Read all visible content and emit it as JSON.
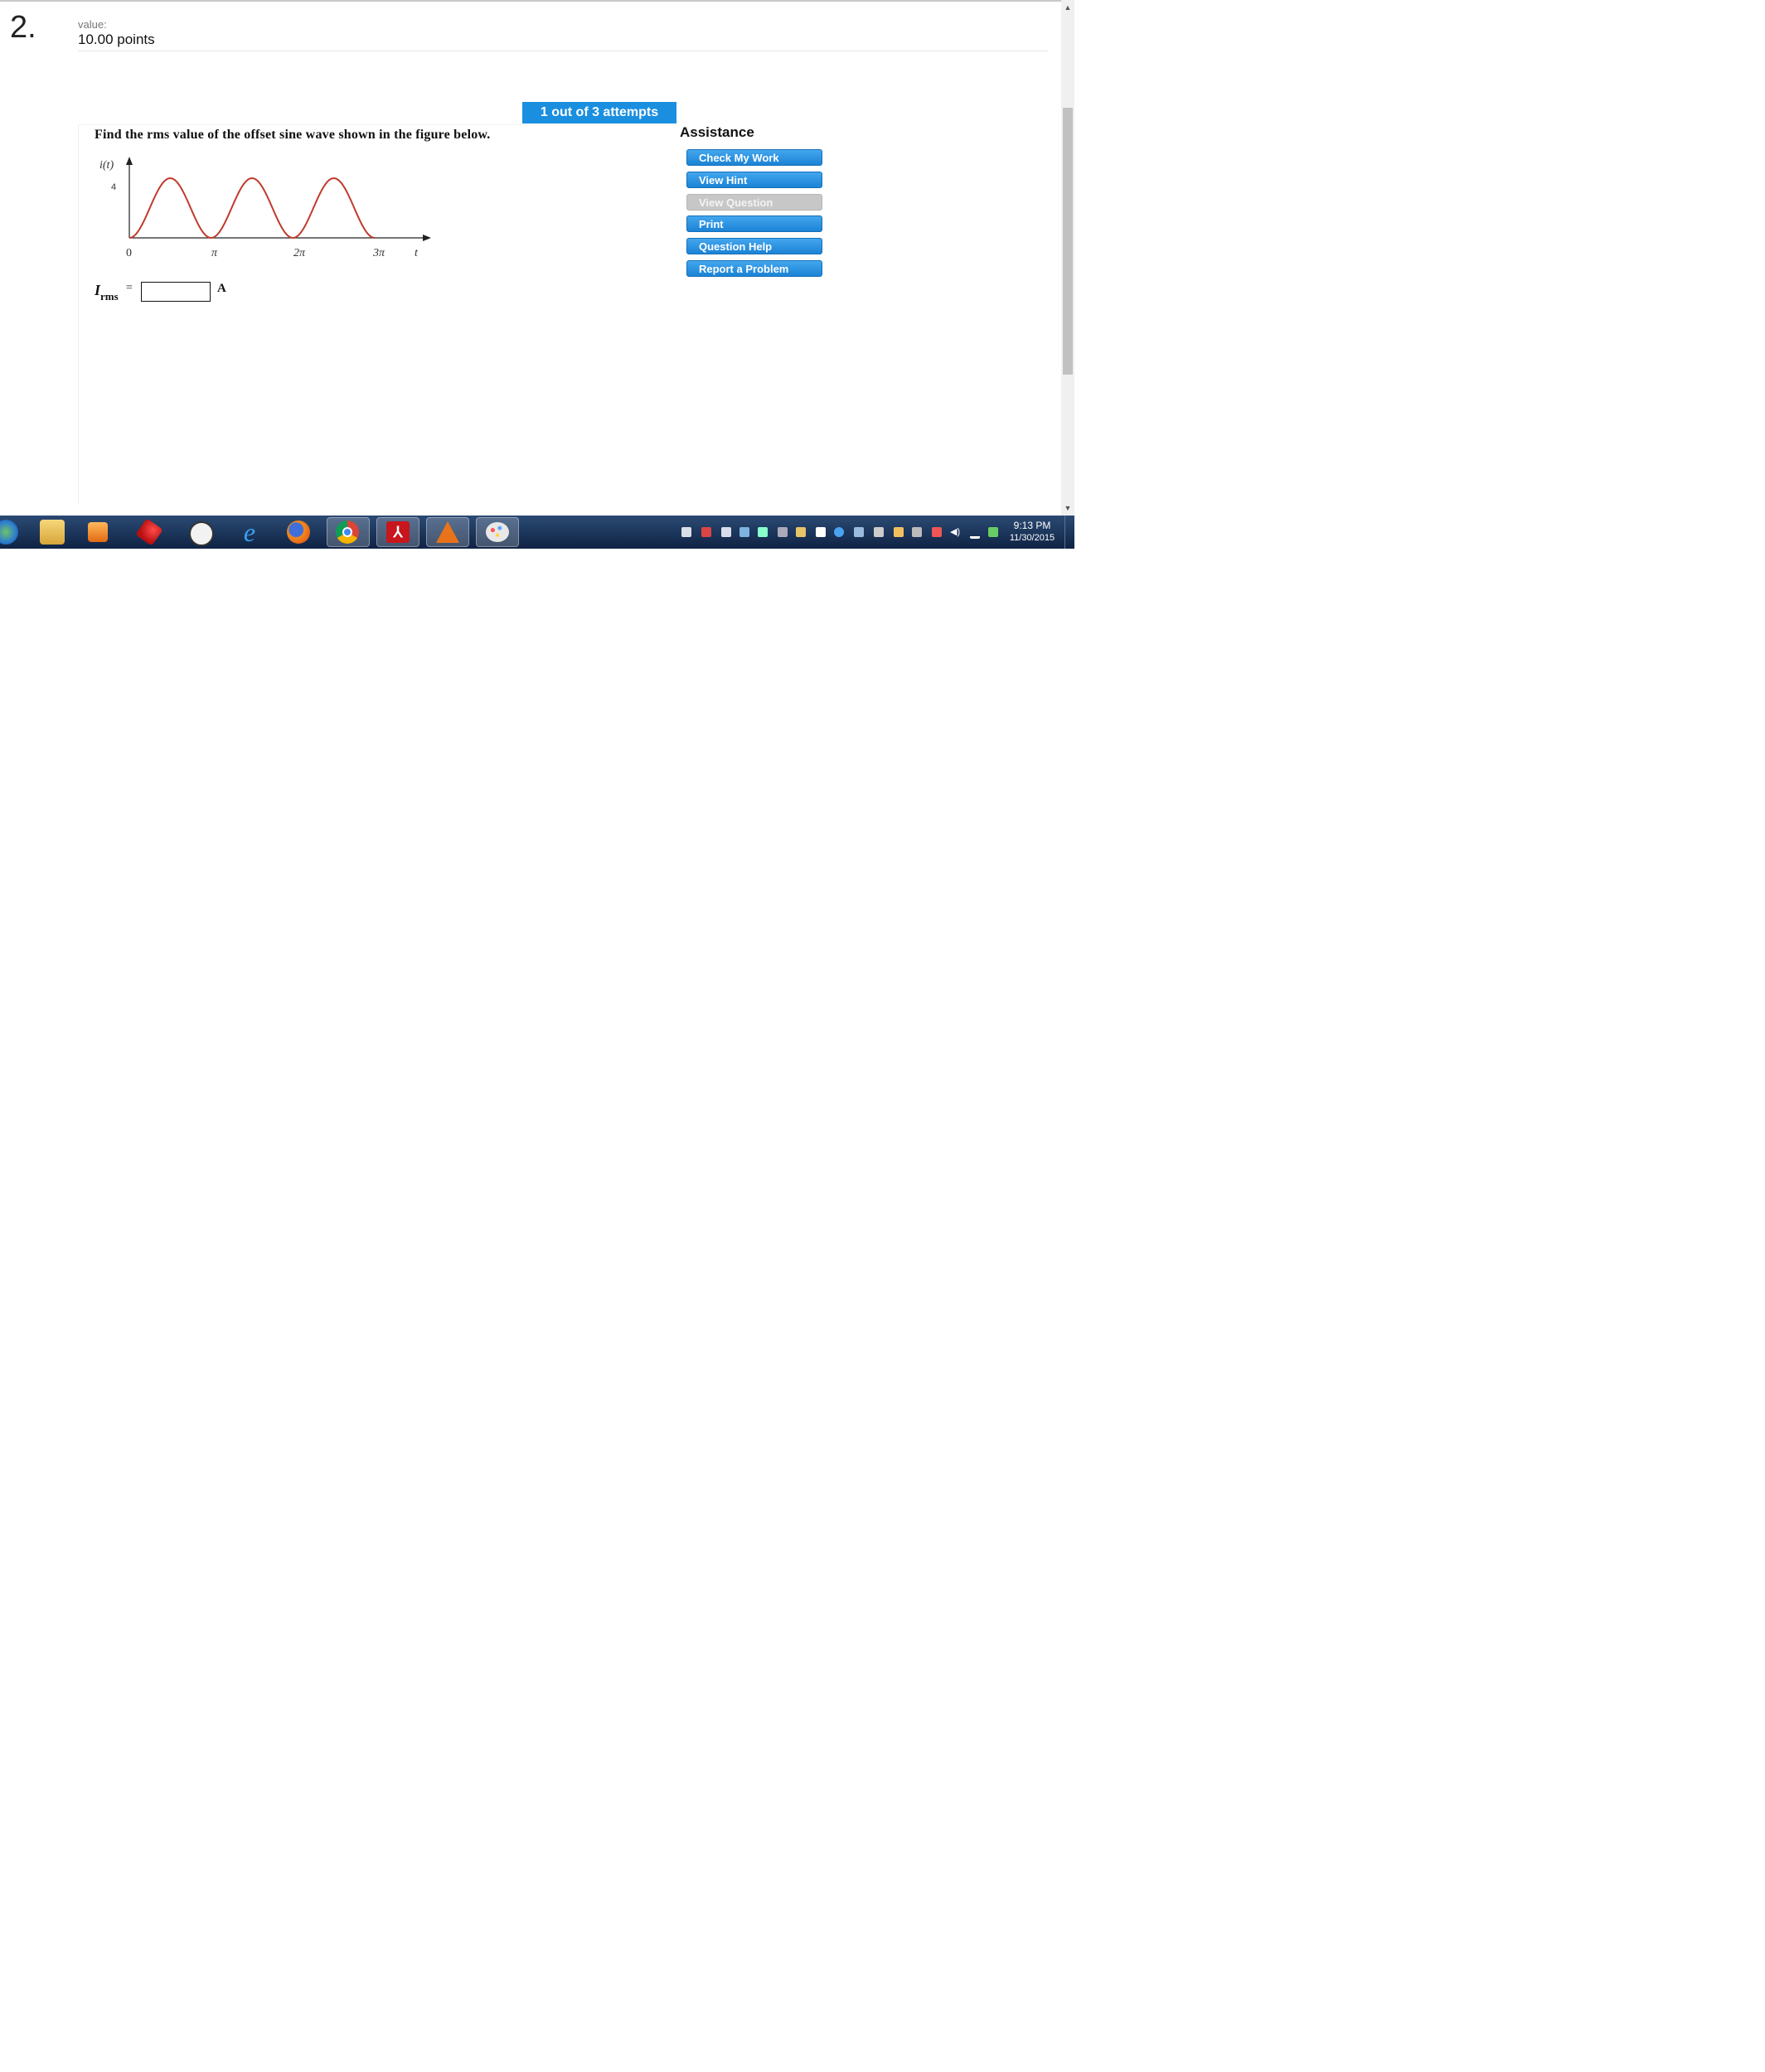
{
  "question": {
    "number": "2.",
    "value_label": "value:",
    "value_points": "10.00 points",
    "attempts": "1 out of 3 attempts",
    "prompt": "Find the rms value of the offset sine wave shown in the figure below.",
    "answer": {
      "var": "I",
      "sub": "rms",
      "equals": "=",
      "value": "",
      "unit": "A"
    }
  },
  "figure": {
    "y_axis_label": "i(t)",
    "y_tick": "4",
    "x_ticks": [
      "0",
      "π",
      "2π",
      "3π"
    ],
    "x_axis_label": "t",
    "wave_color": "#c0392b",
    "amplitude_max": 4,
    "amplitude_min": 0,
    "cycles": 3
  },
  "assistance": {
    "title": "Assistance",
    "buttons": [
      {
        "label": "Check My Work",
        "enabled": true
      },
      {
        "label": "View Hint",
        "enabled": true
      },
      {
        "label": "View Question",
        "enabled": false
      },
      {
        "label": "Print",
        "enabled": true
      },
      {
        "label": "Question Help",
        "enabled": true
      },
      {
        "label": "Report a Problem",
        "enabled": true
      }
    ]
  },
  "taskbar": {
    "apps": [
      "start-orb",
      "file-explorer",
      "media-player",
      "pin-app",
      "clock-app",
      "internet-explorer",
      "firefox",
      "chrome",
      "acrobat",
      "matlab",
      "paint"
    ],
    "clock_time": "9:13 PM",
    "clock_date": "11/30/2015"
  },
  "colors": {
    "accent": "#1a8fe0",
    "disabled": "#c7c7c7"
  }
}
